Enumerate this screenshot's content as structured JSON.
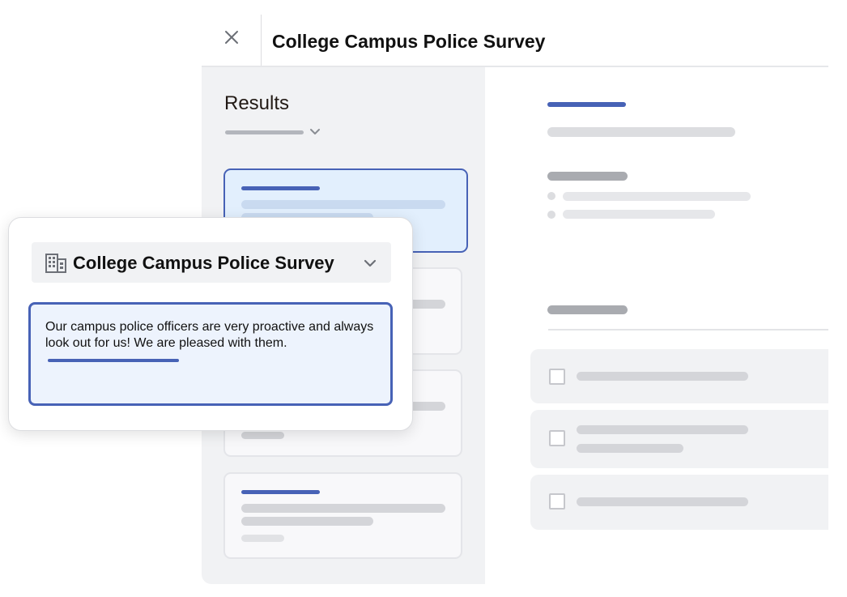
{
  "header": {
    "title": "College Campus Police Survey",
    "close_icon": "close-icon"
  },
  "sidebar": {
    "heading": "Results",
    "sort_icon": "chevron-down-icon"
  },
  "popover": {
    "survey_icon": "building-icon",
    "title": "College Campus Police Survey",
    "dropdown_icon": "chevron-down-icon",
    "response_text": "Our campus police officers are very proactive and always look out for us! We are pleased with them."
  },
  "colors": {
    "accent": "#4762b6",
    "selected_bg": "#e2effd",
    "panel_bg": "#f1f2f4",
    "placeholder": "#d4d5d9"
  }
}
